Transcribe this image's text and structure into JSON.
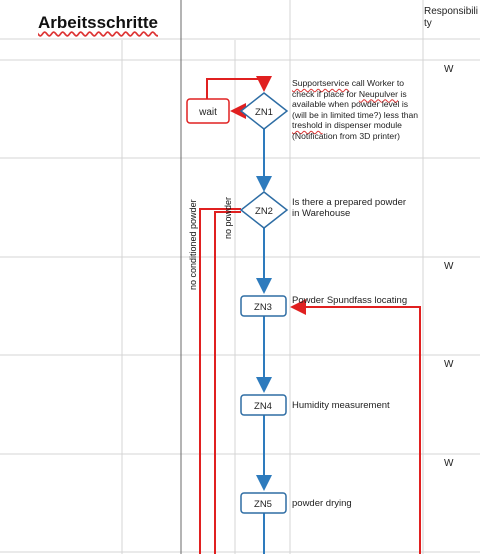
{
  "sheet": {
    "title": "Arbeitsschritte",
    "column_header": "Responsibility"
  },
  "w_marks": [
    "W",
    "W",
    "W",
    "W"
  ],
  "nodes": {
    "zn1": "ZN1",
    "zn2": "ZN2",
    "zn3": "ZN3",
    "zn4": "ZN4",
    "zn5": "ZN5",
    "wait": "wait"
  },
  "descriptions": {
    "zn1": {
      "supportservice": "Supportservice",
      "line1_rest": " call Worker to",
      "line2_a": "check if place for ",
      "neupulver": "Neupulver",
      "line2_b": " is",
      "line3": "available when powder level is",
      "line4": "(will be in limited time?) less than",
      "treshold": "treshold",
      "line5_rest": " in dispenser module",
      "line6": "(Notification from 3D printer)"
    },
    "zn2_line1": "Is there a prepared powder",
    "zn2_line2": "in Warehouse",
    "zn3": "Powder Spundfass locating",
    "zn4": "Humidity measurement",
    "zn5": "powder drying"
  },
  "branch_labels": {
    "no_conditioned_powder": "no conditioned powder",
    "no_powder": "no powder"
  },
  "colors": {
    "flow_blue": "#2e7bbd",
    "red": "#e02020",
    "node_border": "#2e6da4"
  }
}
